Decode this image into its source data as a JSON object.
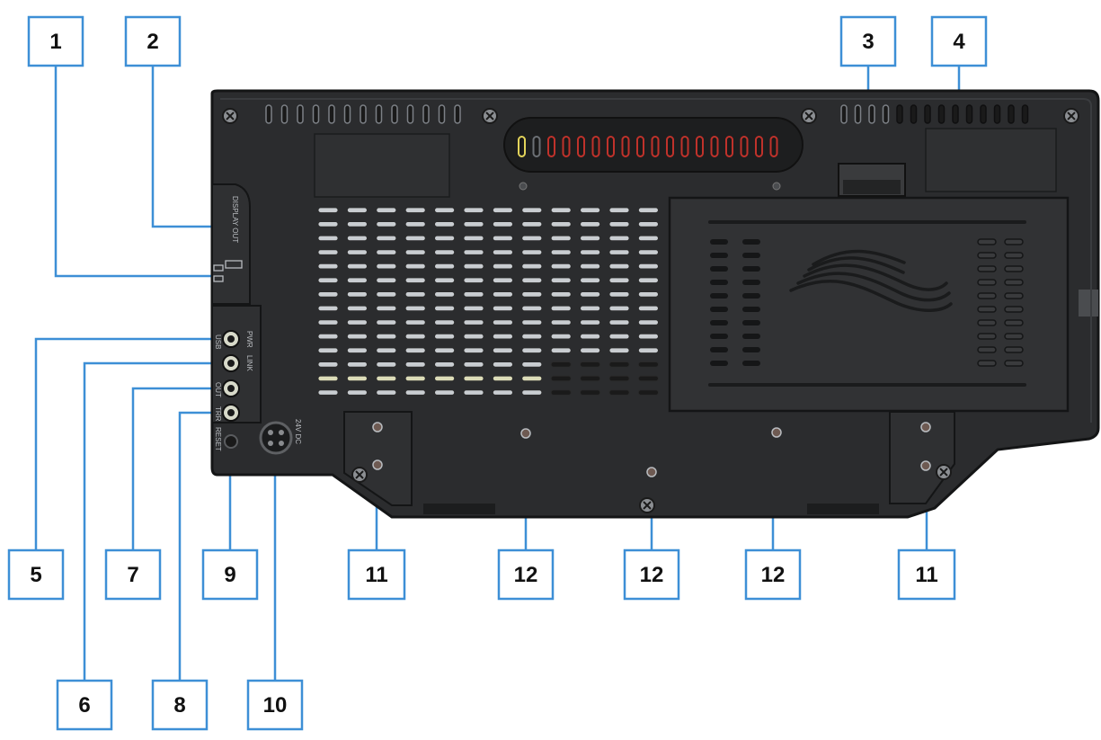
{
  "colors": {
    "callout_border": "#3d8fd6",
    "leader_line": "#3d8fd6",
    "device_body": "#2b2c2e",
    "device_edge": "#141516",
    "panel": "#303133",
    "vent_slot": "#aeb3b9",
    "vent_dark": "#151617",
    "accent_red": "#c0322b",
    "accent_yellow": "#e2d35a"
  },
  "callouts": [
    "1",
    "2",
    "3",
    "4",
    "5",
    "6",
    "7",
    "8",
    "9",
    "10",
    "11",
    "12",
    "12",
    "12",
    "11"
  ],
  "port_labels": {
    "display_out": "DISPLAY OUT",
    "usb": "USB",
    "pwr": "PWR",
    "link": "LINK",
    "out": "OUT",
    "trr": "TRR",
    "reset": "RESET",
    "dc": "24V DC"
  },
  "icons": [
    "screw-icon",
    "vent-grille-icon",
    "wave-logo-icon",
    "power-connector-icon",
    "button-icon"
  ]
}
